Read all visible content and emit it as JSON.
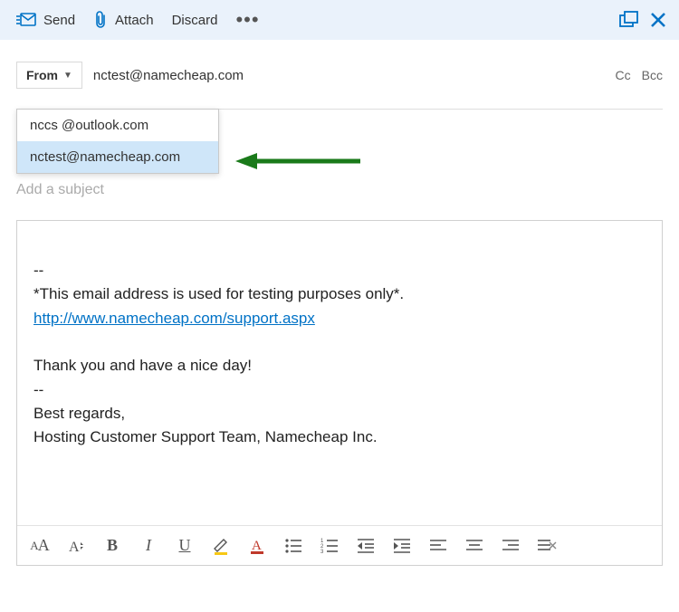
{
  "toolbar": {
    "send": "Send",
    "attach": "Attach",
    "discard": "Discard"
  },
  "from": {
    "label": "From",
    "selected": "nctest@namecheap.com",
    "options": [
      {
        "label": "nccs @outlook.com",
        "selected": false
      },
      {
        "label": "nctest@namecheap.com",
        "selected": true
      }
    ]
  },
  "recipients": {
    "cc_label": "Cc",
    "bcc_label": "Bcc"
  },
  "subject": {
    "placeholder": "Add a subject",
    "value": ""
  },
  "body": {
    "line1": "--",
    "line2": "*This email address is used for testing purposes only*.",
    "link_text": "http://www.namecheap.com/support.aspx",
    "blank": "",
    "line3": "Thank you and have a nice day!",
    "line4": "--",
    "line5": "Best regards,",
    "line6": "Hosting Customer Support Team, Namecheap Inc."
  },
  "annotation": {
    "arrow_color": "#1a7a1a"
  },
  "colors": {
    "accent": "#0072c6",
    "toolbar_bg": "#eaf2fb",
    "highlight": "#f7c815"
  },
  "format_bar": {
    "items": [
      "font-family",
      "font-size",
      "bold",
      "italic",
      "underline",
      "highlight",
      "font-color",
      "bullet-list",
      "number-list",
      "indent-decrease",
      "indent-increase",
      "align-left",
      "align-center",
      "align-right",
      "clear-formatting"
    ]
  }
}
